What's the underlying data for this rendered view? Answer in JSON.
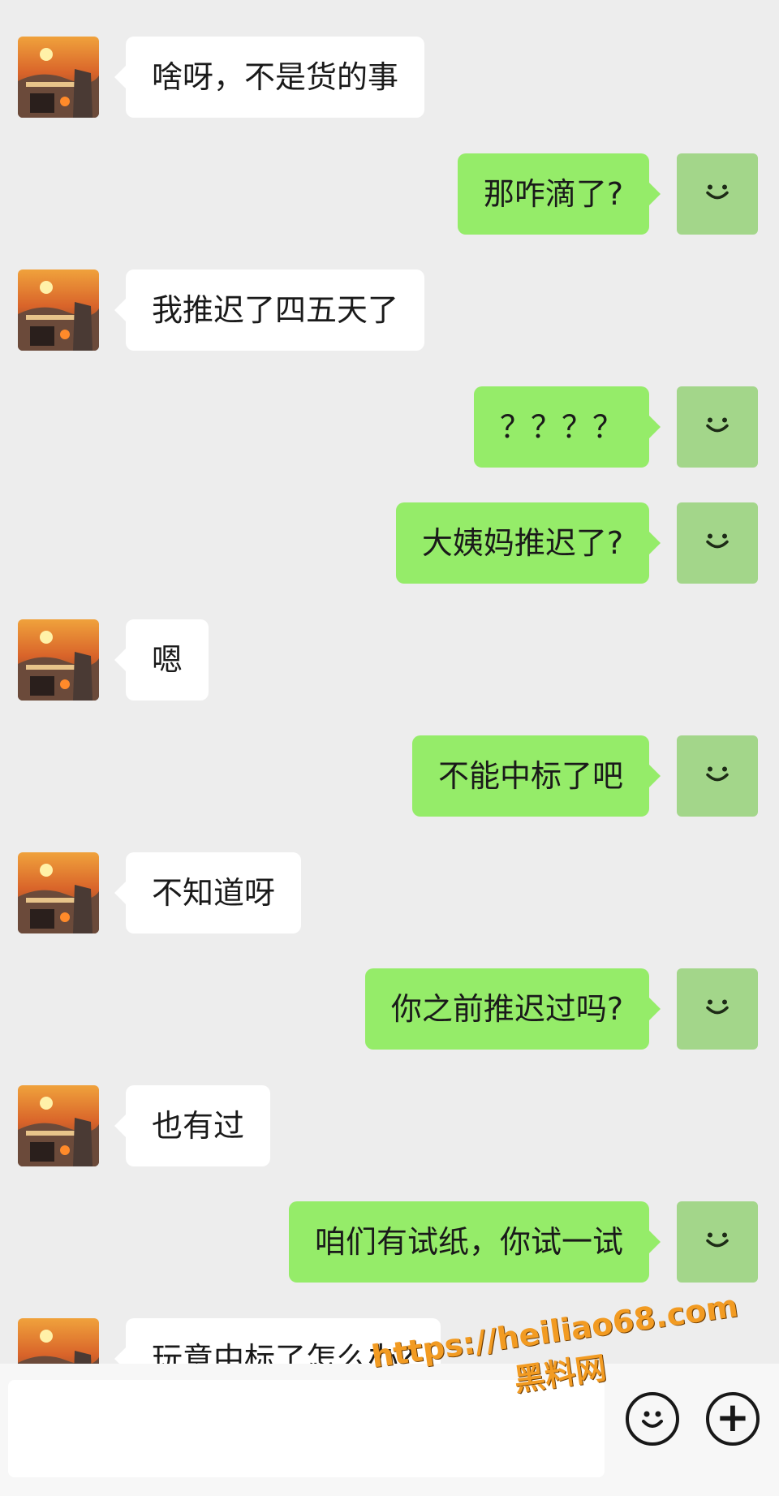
{
  "messages": [
    {
      "side": "in",
      "text": "啥呀，不是货的事"
    },
    {
      "side": "out",
      "text": "那咋滴了?"
    },
    {
      "side": "in",
      "text": "我推迟了四五天了"
    },
    {
      "side": "out",
      "text": "？？？？"
    },
    {
      "side": "out",
      "text": "大姨妈推迟了?"
    },
    {
      "side": "in",
      "text": "嗯"
    },
    {
      "side": "out",
      "text": "不能中标了吧"
    },
    {
      "side": "in",
      "text": "不知道呀"
    },
    {
      "side": "out",
      "text": "你之前推迟过吗?"
    },
    {
      "side": "in",
      "text": "也有过"
    },
    {
      "side": "out",
      "text": "咱们有试纸，你试一试"
    },
    {
      "side": "in",
      "text": "玩意中标了怎么办?"
    }
  ],
  "avatars": {
    "self_icon": "smiley-avatar-icon",
    "contact_icon": "sunset-avatar-image"
  },
  "input_bar": {
    "placeholder": "",
    "emoji_icon": "emoji-smile-icon",
    "plus_icon": "plus-icon",
    "plus_label": "+"
  },
  "watermark": {
    "url": "https://heiliao68.com",
    "name": "黑料网"
  },
  "colors": {
    "background": "#ededed",
    "outgoing_bubble": "#95ec69",
    "incoming_bubble": "#ffffff",
    "self_avatar": "#a3d68a",
    "watermark": "#f29b22"
  }
}
